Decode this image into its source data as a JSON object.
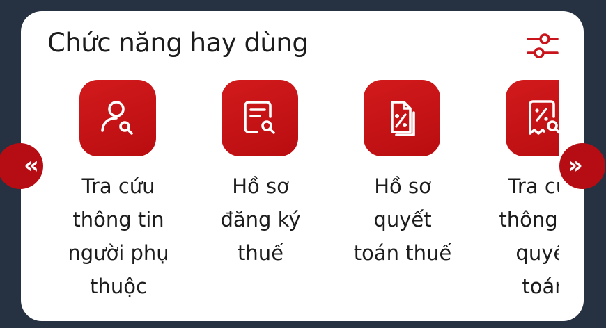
{
  "panel": {
    "title": "Chức năng hay dùng",
    "settings_icon": "sliders-icon"
  },
  "colors": {
    "accent": "#c8141a",
    "background": "#263241",
    "card": "#ffffff",
    "text": "#1c1c1c"
  },
  "nav": {
    "prev_label": "«",
    "next_label": "»"
  },
  "items": [
    {
      "icon": "user-search-icon",
      "label": "Tra cứu\nthông tin\nngười phụ\nthuộc"
    },
    {
      "icon": "document-search-icon",
      "label": "Hồ sơ\nđăng ký\nthuế"
    },
    {
      "icon": "tax-document-icon",
      "label": "Hồ sơ\nquyết\ntoán thuế"
    },
    {
      "icon": "receipt-search-icon",
      "label": "Tra cứu\nthông tin\nquyết\ntoán"
    }
  ]
}
